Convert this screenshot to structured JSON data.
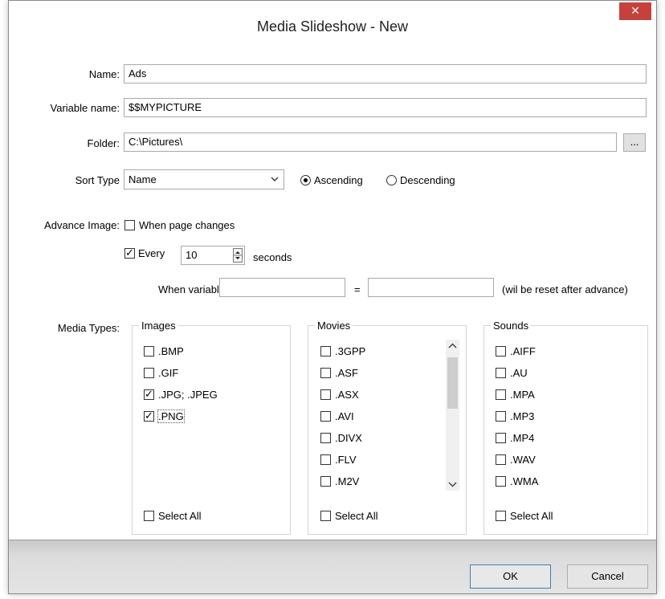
{
  "window": {
    "title": "Media Slideshow - New",
    "close_glyph": "✕"
  },
  "form": {
    "name_label": "Name:",
    "name_value": "Ads",
    "variable_label": "Variable name:",
    "variable_value": "$$MYPICTURE",
    "folder_label": "Folder:",
    "folder_value": "C:\\Pictures\\",
    "browse_label": "...",
    "sort_label": "Sort Type",
    "sort_value": "Name",
    "ascending_label": "Ascending",
    "descending_label": "Descending",
    "sort_order": "Ascending",
    "advance_label": "Advance Image:",
    "page_changes_label": "When page changes",
    "page_changes_checked": false,
    "every_label": "Every",
    "every_checked": true,
    "every_value": "10",
    "seconds_label": "seconds",
    "when_variable_label": "When variable:",
    "when_variable_value": "",
    "equals_label": "=",
    "when_variable_target": "",
    "reset_note": "(wil be reset after advance)"
  },
  "media_types": {
    "label": "Media Types:",
    "images": {
      "title": "Images",
      "items": [
        {
          "label": ".BMP",
          "checked": false
        },
        {
          "label": ".GIF",
          "checked": false
        },
        {
          "label": ".JPG; .JPEG",
          "checked": true
        },
        {
          "label": ".PNG",
          "checked": true
        }
      ],
      "select_all": "Select All"
    },
    "movies": {
      "title": "Movies",
      "items": [
        {
          "label": ".3GPP",
          "checked": false
        },
        {
          "label": ".ASF",
          "checked": false
        },
        {
          "label": ".ASX",
          "checked": false
        },
        {
          "label": ".AVI",
          "checked": false
        },
        {
          "label": ".DIVX",
          "checked": false
        },
        {
          "label": ".FLV",
          "checked": false
        },
        {
          "label": ".M2V",
          "checked": false
        }
      ],
      "select_all": "Select All"
    },
    "sounds": {
      "title": "Sounds",
      "items": [
        {
          "label": ".AIFF",
          "checked": false
        },
        {
          "label": ".AU",
          "checked": false
        },
        {
          "label": ".MPA",
          "checked": false
        },
        {
          "label": ".MP3",
          "checked": false
        },
        {
          "label": ".MP4",
          "checked": false
        },
        {
          "label": ".WAV",
          "checked": false
        },
        {
          "label": ".WMA",
          "checked": false
        }
      ],
      "select_all": "Select All"
    }
  },
  "buttons": {
    "ok": "OK",
    "cancel": "Cancel"
  },
  "icons": {
    "close": "close-icon",
    "dropdown": "chevron-down-icon",
    "spin": "spinner-icon",
    "scroll_up": "chevron-up-icon",
    "scroll_down": "chevron-down-icon"
  },
  "colors": {
    "close_button": "#c7413c",
    "dialog_bg": "#f0f0f0"
  }
}
